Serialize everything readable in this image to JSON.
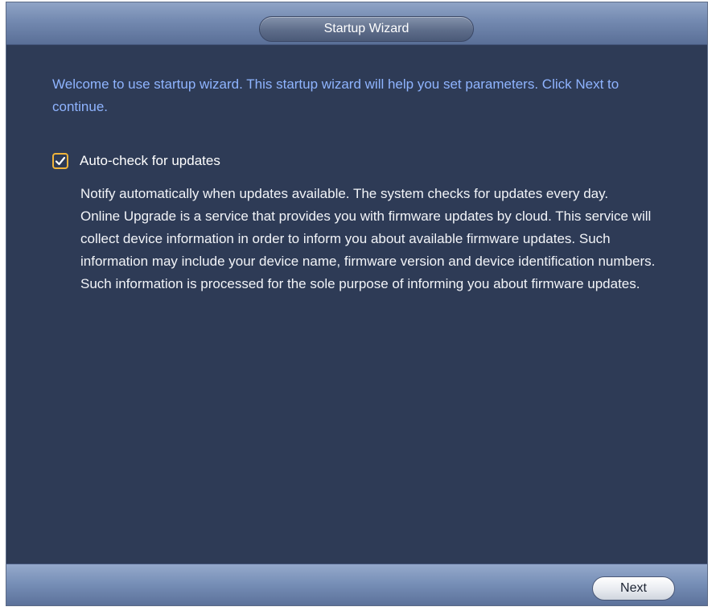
{
  "window": {
    "title": "Startup Wizard"
  },
  "main": {
    "welcome_text": "Welcome to use startup wizard. This startup wizard will help you set parameters. Click Next to continue.",
    "auto_check": {
      "label": "Auto-check for updates",
      "checked": true
    },
    "description": [
      "Notify automatically when updates available. The system checks for updates every day.",
      "Online Upgrade is a service that provides you with firmware updates by cloud. This service will collect device information in order to inform you about available firmware updates. Such information may include your device name, firmware version and device identification numbers. Such information is processed for the sole purpose of informing you about firmware updates."
    ]
  },
  "footer": {
    "next_label": "Next"
  },
  "colors": {
    "background": "#2e3b56",
    "accent_text": "#8fb4ff",
    "checkbox": "#f0b43a"
  },
  "icons": {
    "checkbox": "checkmark-icon"
  }
}
